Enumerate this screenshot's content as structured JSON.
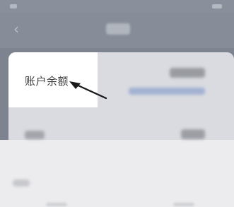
{
  "nav": {
    "back_icon": "chevron-left-icon"
  },
  "account": {
    "balance_label": "账户余额"
  },
  "annotation": {
    "arrow_color": "#1a1a1a"
  },
  "colors": {
    "overlay": "#7d838f",
    "card": "#ffffff"
  }
}
